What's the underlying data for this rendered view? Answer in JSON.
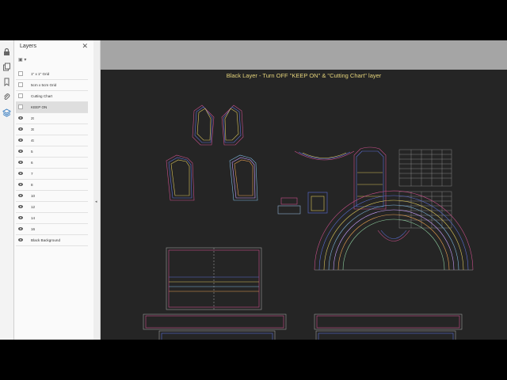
{
  "layers_panel": {
    "title": "Layers",
    "close_glyph": "✕",
    "options_glyph": "▣ ▾",
    "layers": [
      {
        "label": "1\" x 1\" Grid",
        "visible": false
      },
      {
        "label": "5cm x 5cm Grid",
        "visible": false
      },
      {
        "label": "Cutting Chart",
        "visible": false
      },
      {
        "label": "KEEP ON",
        "visible": false
      },
      {
        "label": "2t",
        "visible": true
      },
      {
        "label": "3t",
        "visible": true
      },
      {
        "label": "4t",
        "visible": true
      },
      {
        "label": "5",
        "visible": true
      },
      {
        "label": "6",
        "visible": true
      },
      {
        "label": "7",
        "visible": true
      },
      {
        "label": "8",
        "visible": true
      },
      {
        "label": "10",
        "visible": true
      },
      {
        "label": "12",
        "visible": true
      },
      {
        "label": "14",
        "visible": true
      },
      {
        "label": "16",
        "visible": true
      },
      {
        "label": "Black Background",
        "visible": true
      }
    ],
    "selected_layer": "KEEP ON"
  },
  "tool_rail": {
    "icons": [
      "lock-icon",
      "pages-icon",
      "bookmark-icon",
      "attachment-icon",
      "layers-icon"
    ]
  },
  "document": {
    "title": "Black Layer - Turn OFF \"KEEP ON\" & \"Cutting Chart\" layer",
    "background_color": "#252525",
    "title_color": "#e3d27a"
  },
  "collapse_glyph": "◂"
}
